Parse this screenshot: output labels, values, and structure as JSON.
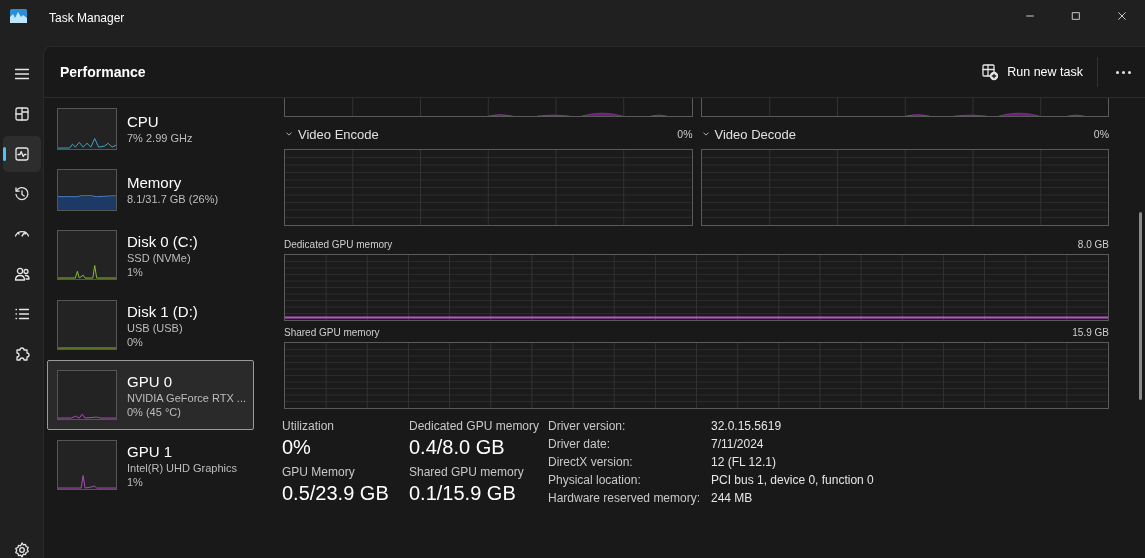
{
  "window": {
    "title": "Task Manager"
  },
  "nav": [
    {
      "kind": "processes",
      "selected": false
    },
    {
      "kind": "performance",
      "selected": true
    },
    {
      "kind": "history",
      "selected": false
    },
    {
      "kind": "startup",
      "selected": false
    },
    {
      "kind": "users",
      "selected": false
    },
    {
      "kind": "details",
      "selected": false
    },
    {
      "kind": "services",
      "selected": false
    }
  ],
  "header": {
    "title": "Performance",
    "run_task": "Run new task"
  },
  "devices": [
    {
      "kind": "cpu",
      "name": "CPU",
      "lines": [
        "7%  2.99 GHz"
      ],
      "selected": false
    },
    {
      "kind": "memory",
      "name": "Memory",
      "lines": [
        "8.1/31.7 GB (26%)"
      ],
      "selected": false
    },
    {
      "kind": "disk",
      "name": "Disk 0 (C:)",
      "lines": [
        "SSD (NVMe)",
        "1%"
      ],
      "selected": false
    },
    {
      "kind": "disk",
      "name": "Disk 1 (D:)",
      "lines": [
        "USB (USB)",
        "0%"
      ],
      "selected": false
    },
    {
      "kind": "gpu",
      "name": "GPU 0",
      "lines": [
        "NVIDIA GeForce RTX ...",
        "0%  (45 °C)"
      ],
      "selected": true
    },
    {
      "kind": "gpu",
      "name": "GPU 1",
      "lines": [
        "Intel(R) UHD Graphics",
        "1%"
      ],
      "selected": false
    }
  ],
  "engines": [
    {
      "name": "Video Encode",
      "reading": "0%"
    },
    {
      "name": "Video Decode",
      "reading": "0%"
    }
  ],
  "memory_graphs": [
    {
      "label": "Dedicated GPU memory",
      "max": "8.0 GB"
    },
    {
      "label": "Shared GPU memory",
      "max": "15.9 GB"
    }
  ],
  "stats": [
    {
      "label": "Utilization",
      "value": "0%"
    },
    {
      "label": "Dedicated GPU memory",
      "value": "0.4/8.0 GB"
    },
    {
      "label": "GPU Memory",
      "value": "0.5/23.9 GB"
    },
    {
      "label": "Shared GPU memory",
      "value": "0.1/15.9 GB"
    }
  ],
  "details": [
    {
      "label": "Driver version:",
      "value": "32.0.15.5619"
    },
    {
      "label": "Driver date:",
      "value": "7/11/2024"
    },
    {
      "label": "DirectX version:",
      "value": "12 (FL 12.1)"
    },
    {
      "label": "Physical location:",
      "value": "PCI bus 1, device 0, function 0"
    },
    {
      "label": "Hardware reserved memory:",
      "value": "244 MB"
    }
  ]
}
